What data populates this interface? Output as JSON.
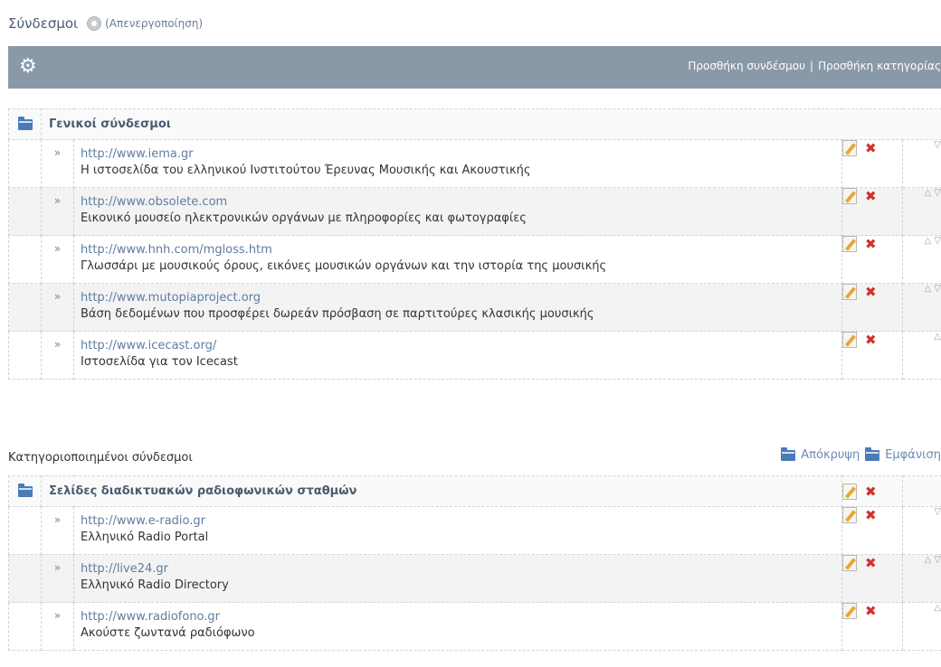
{
  "page": {
    "title": "Σύνδεσμοι",
    "disable_label": "(Απενεργοποίηση)"
  },
  "toolbar": {
    "add_link": "Προσθήκη συνδέσμου",
    "separator": "|",
    "add_category": "Προσθήκη κατηγορίας"
  },
  "general": {
    "category_name": "Γενικοί σύνδεσμοι",
    "links": [
      {
        "url": "http://www.iema.gr",
        "description": "Η ιστοσελίδα του ελληνικού Ινστιτούτου Έρευνας Μουσικής και Ακουστικής",
        "arrows": "▽"
      },
      {
        "url": "http://www.obsolete.com",
        "description": "Εικονικό μουσείο ηλεκτρονικών οργάνων με πληροφορίες και φωτογραφίες",
        "arrows": "△ ▽"
      },
      {
        "url": "http://www.hnh.com/mgloss.htm",
        "description": "Γλωσσάρι με μουσικούς όρους, εικόνες μουσικών οργάνων και την ιστορία της μουσικής",
        "arrows": "△ ▽"
      },
      {
        "url": "http://www.mutopiaproject.org",
        "description": "Βάση δεδομένων που προσφέρει δωρεάν πρόσβαση σε παρτιτούρες κλασικής μουσικής",
        "arrows": "△ ▽"
      },
      {
        "url": "http://www.icecast.org/",
        "description": "Ιστοσελίδα για τον Icecast",
        "arrows": "△"
      }
    ]
  },
  "categorized": {
    "heading": "Κατηγοριοποιημένοι σύνδεσμοι",
    "hide_label": "Απόκρυψη",
    "show_label": "Εμφάνιση",
    "category_name": "Σελίδες διαδικτυακών ραδιοφωνικών σταθμών",
    "links": [
      {
        "url": "http://www.e-radio.gr",
        "description": "Ελληνικό Radio Portal",
        "arrows": "▽"
      },
      {
        "url": "http://live24.gr",
        "description": "Ελληνικό Radio Directory",
        "arrows": "△ ▽"
      },
      {
        "url": "http://www.radiofono.gr",
        "description": "Ακούστε ζωντανά ραδιόφωνο",
        "arrows": "△"
      }
    ]
  },
  "icons": {
    "raquo": "»",
    "delete": "✖",
    "settings": "⚙"
  },
  "colors": {
    "toolbar_bg": "#8a99a8",
    "link_color": "#5f7d9e",
    "delete_red": "#d3302a",
    "folder_blue": "#4a7bb7"
  }
}
